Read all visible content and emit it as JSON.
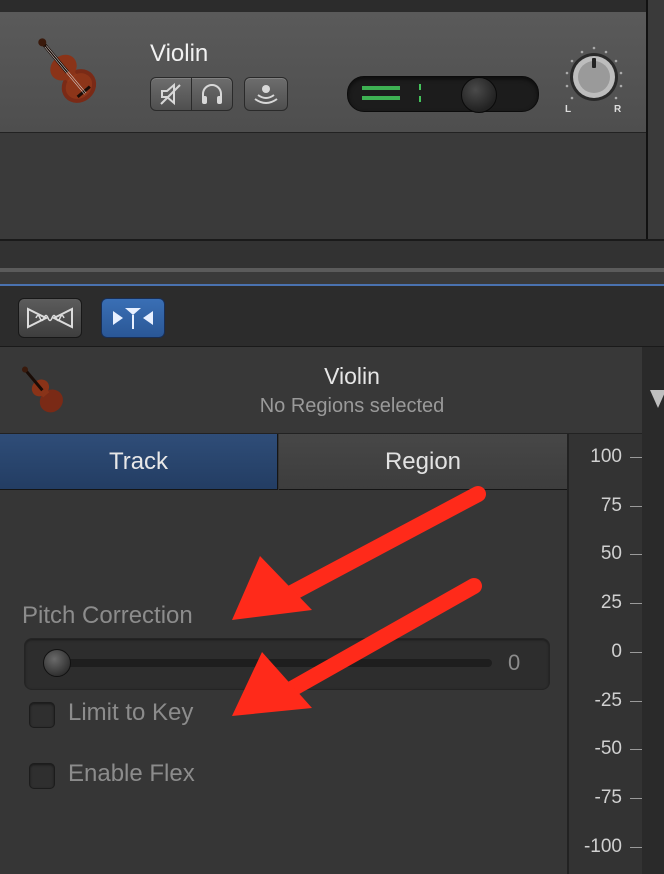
{
  "track": {
    "name": "Violin",
    "mute_icon": "speaker-mute-icon",
    "solo_icon": "headphones-icon",
    "monitor_icon": "input-monitor-icon",
    "pan_left": "L",
    "pan_right": "R"
  },
  "toolbar": {
    "editor_toggle_icon": "waveform-toggle-icon",
    "smart_controls_icon": "smart-controls-icon"
  },
  "inspector": {
    "title": "Violin",
    "subtitle": "No Regions selected"
  },
  "tabs": {
    "track": "Track",
    "region": "Region",
    "active": "Track"
  },
  "pitch_correction": {
    "label": "Pitch Correction",
    "value": "0"
  },
  "limit_to_key": {
    "label": "Limit to Key",
    "checked": false
  },
  "enable_flex": {
    "label": "Enable Flex",
    "checked": false
  },
  "ruler": {
    "ticks": [
      "100",
      "75",
      "50",
      "25",
      "0",
      "-25",
      "-50",
      "-75",
      "-100"
    ]
  },
  "colors": {
    "active_tab": "#2f4d78",
    "annotation_arrow": "#ff2a1a",
    "accent_blue": "#3a6fb5",
    "meter_green": "#43c25a"
  }
}
